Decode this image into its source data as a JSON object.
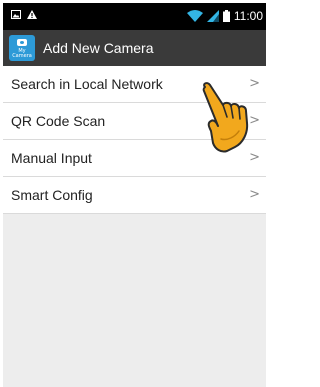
{
  "status_bar": {
    "time": "11:00",
    "left_icons": [
      "image-icon",
      "warning-icon"
    ],
    "right_icons": [
      "wifi-icon",
      "signal-icon",
      "battery-icon"
    ]
  },
  "app_bar": {
    "title": "Add New Camera",
    "icon": "camera-app-icon",
    "icon_text": "My Camera"
  },
  "menu": {
    "items": [
      {
        "label": "Search in Local Network",
        "chevron": ">"
      },
      {
        "label": "QR Code Scan",
        "chevron": ">"
      },
      {
        "label": "Manual Input",
        "chevron": ">"
      },
      {
        "label": "Smart Config",
        "chevron": ">"
      }
    ]
  },
  "overlay": {
    "icon": "hand-pointer-icon",
    "color": "#f2a81d"
  },
  "colors": {
    "status_bar_bg": "#000000",
    "app_bar_bg": "#3a3a3a",
    "app_icon_bg": "#2d9ad7",
    "list_bg": "#ffffff",
    "page_bg": "#ededed",
    "wifi_accent": "#33b5e5"
  }
}
